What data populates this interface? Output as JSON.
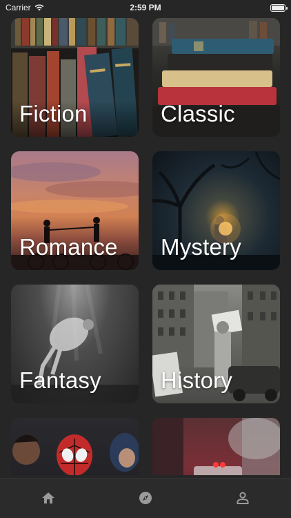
{
  "status_bar": {
    "carrier": "Carrier",
    "time": "2:59 PM"
  },
  "categories": [
    {
      "label": "Fiction"
    },
    {
      "label": "Classic"
    },
    {
      "label": "Romance"
    },
    {
      "label": "Mystery"
    },
    {
      "label": "Fantasy"
    },
    {
      "label": "History"
    },
    {
      "label": ""
    },
    {
      "label": ""
    }
  ],
  "tab_bar": {
    "tabs": [
      {
        "icon": "home-icon"
      },
      {
        "icon": "compass-icon"
      },
      {
        "icon": "profile-icon"
      }
    ],
    "icon_color": "#9a9a9a"
  }
}
